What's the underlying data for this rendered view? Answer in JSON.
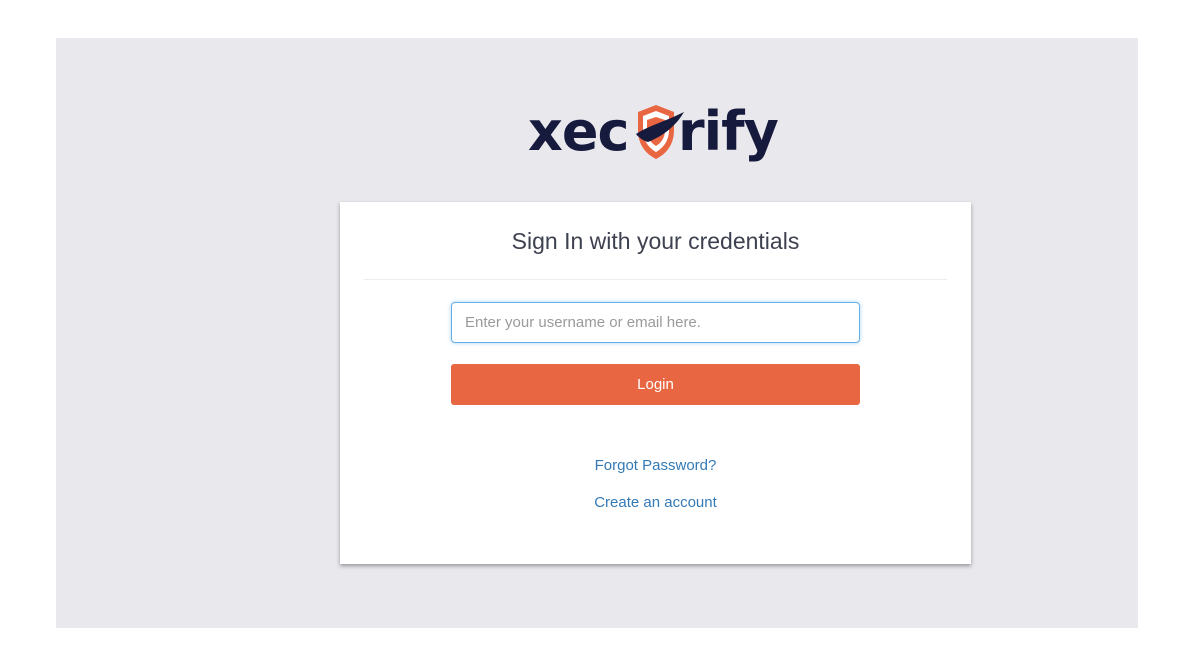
{
  "brand": {
    "logo_text_left": "xec",
    "logo_text_right": "rify",
    "logo_icon": "shield-icon",
    "primary_color": "#e96643",
    "dark_color": "#161a3d"
  },
  "signin": {
    "title": "Sign In with your credentials",
    "username_placeholder": "Enter your username or email here.",
    "username_value": "",
    "login_label": "Login",
    "forgot_password": "Forgot Password?",
    "create_account": "Create an account"
  }
}
